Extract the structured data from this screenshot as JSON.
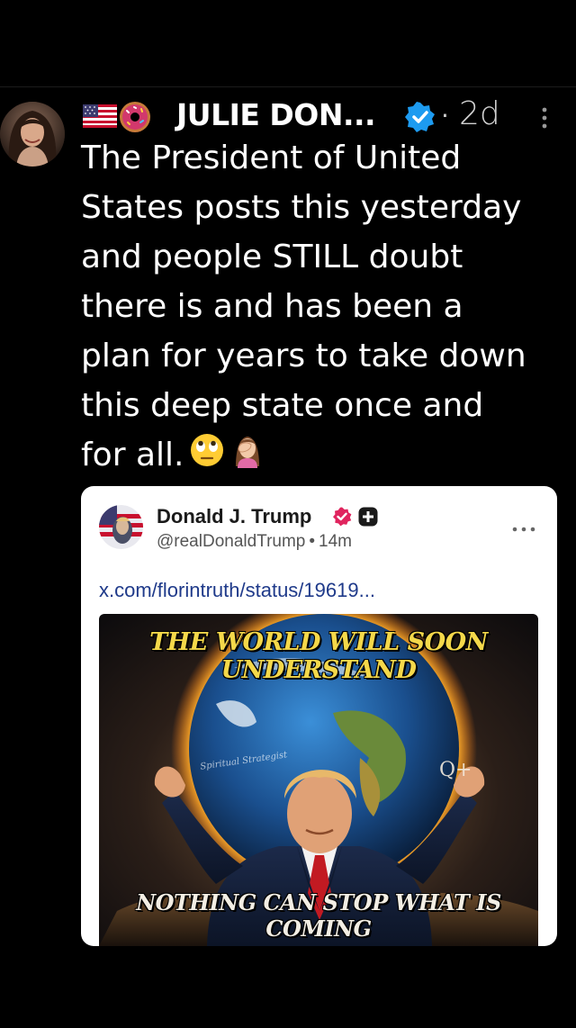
{
  "post": {
    "author_display_name": "JULIE DON...",
    "timestamp": "2d",
    "text_lines": [
      "The President of United",
      "States posts this yesterday",
      "and people STILL doubt",
      "there is and has been a",
      "plan for years to take down",
      "this deep state once and",
      "for all."
    ]
  },
  "icons": {
    "flag": "us-flag-icon",
    "donut": "donut-icon",
    "verified": "verified-badge-icon",
    "more": "more-vertical-icon",
    "emoji_eye_roll": "face-with-rolling-eyes-icon",
    "emoji_facepalm": "woman-facepalming-icon"
  },
  "embedded": {
    "name": "Donald J. Trump",
    "handle": "@realDonaldTrump",
    "separator": "•",
    "time": "14m",
    "link": "x.com/florintruth/status/19619...",
    "image_top_text": "THE WORLD WILL SOON UNDERSTAND",
    "image_bottom_text": "NOTHING CAN STOP WHAT IS COMING",
    "image_watermark": "Spiritual Strategist"
  },
  "colors": {
    "background": "#000000",
    "verified_blue": "#1d9bf0",
    "badge_pink": "#e0245e",
    "link_blue": "#1f3a8a",
    "image_text_yellow": "#f4d84a"
  }
}
